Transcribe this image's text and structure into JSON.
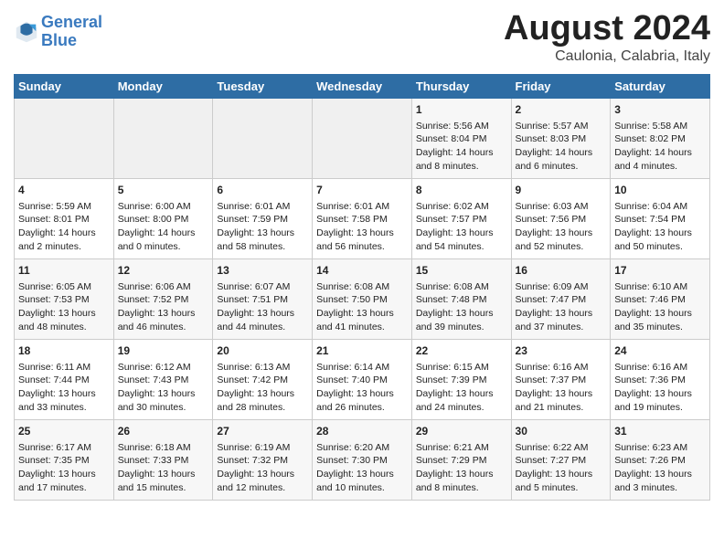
{
  "header": {
    "logo_line1": "General",
    "logo_line2": "Blue",
    "main_title": "August 2024",
    "subtitle": "Caulonia, Calabria, Italy"
  },
  "calendar": {
    "days_of_week": [
      "Sunday",
      "Monday",
      "Tuesday",
      "Wednesday",
      "Thursday",
      "Friday",
      "Saturday"
    ],
    "weeks": [
      [
        {
          "day": "",
          "lines": []
        },
        {
          "day": "",
          "lines": []
        },
        {
          "day": "",
          "lines": []
        },
        {
          "day": "",
          "lines": []
        },
        {
          "day": "1",
          "lines": [
            "Sunrise: 5:56 AM",
            "Sunset: 8:04 PM",
            "Daylight: 14 hours",
            "and 8 minutes."
          ]
        },
        {
          "day": "2",
          "lines": [
            "Sunrise: 5:57 AM",
            "Sunset: 8:03 PM",
            "Daylight: 14 hours",
            "and 6 minutes."
          ]
        },
        {
          "day": "3",
          "lines": [
            "Sunrise: 5:58 AM",
            "Sunset: 8:02 PM",
            "Daylight: 14 hours",
            "and 4 minutes."
          ]
        }
      ],
      [
        {
          "day": "4",
          "lines": [
            "Sunrise: 5:59 AM",
            "Sunset: 8:01 PM",
            "Daylight: 14 hours",
            "and 2 minutes."
          ]
        },
        {
          "day": "5",
          "lines": [
            "Sunrise: 6:00 AM",
            "Sunset: 8:00 PM",
            "Daylight: 14 hours",
            "and 0 minutes."
          ]
        },
        {
          "day": "6",
          "lines": [
            "Sunrise: 6:01 AM",
            "Sunset: 7:59 PM",
            "Daylight: 13 hours",
            "and 58 minutes."
          ]
        },
        {
          "day": "7",
          "lines": [
            "Sunrise: 6:01 AM",
            "Sunset: 7:58 PM",
            "Daylight: 13 hours",
            "and 56 minutes."
          ]
        },
        {
          "day": "8",
          "lines": [
            "Sunrise: 6:02 AM",
            "Sunset: 7:57 PM",
            "Daylight: 13 hours",
            "and 54 minutes."
          ]
        },
        {
          "day": "9",
          "lines": [
            "Sunrise: 6:03 AM",
            "Sunset: 7:56 PM",
            "Daylight: 13 hours",
            "and 52 minutes."
          ]
        },
        {
          "day": "10",
          "lines": [
            "Sunrise: 6:04 AM",
            "Sunset: 7:54 PM",
            "Daylight: 13 hours",
            "and 50 minutes."
          ]
        }
      ],
      [
        {
          "day": "11",
          "lines": [
            "Sunrise: 6:05 AM",
            "Sunset: 7:53 PM",
            "Daylight: 13 hours",
            "and 48 minutes."
          ]
        },
        {
          "day": "12",
          "lines": [
            "Sunrise: 6:06 AM",
            "Sunset: 7:52 PM",
            "Daylight: 13 hours",
            "and 46 minutes."
          ]
        },
        {
          "day": "13",
          "lines": [
            "Sunrise: 6:07 AM",
            "Sunset: 7:51 PM",
            "Daylight: 13 hours",
            "and 44 minutes."
          ]
        },
        {
          "day": "14",
          "lines": [
            "Sunrise: 6:08 AM",
            "Sunset: 7:50 PM",
            "Daylight: 13 hours",
            "and 41 minutes."
          ]
        },
        {
          "day": "15",
          "lines": [
            "Sunrise: 6:08 AM",
            "Sunset: 7:48 PM",
            "Daylight: 13 hours",
            "and 39 minutes."
          ]
        },
        {
          "day": "16",
          "lines": [
            "Sunrise: 6:09 AM",
            "Sunset: 7:47 PM",
            "Daylight: 13 hours",
            "and 37 minutes."
          ]
        },
        {
          "day": "17",
          "lines": [
            "Sunrise: 6:10 AM",
            "Sunset: 7:46 PM",
            "Daylight: 13 hours",
            "and 35 minutes."
          ]
        }
      ],
      [
        {
          "day": "18",
          "lines": [
            "Sunrise: 6:11 AM",
            "Sunset: 7:44 PM",
            "Daylight: 13 hours",
            "and 33 minutes."
          ]
        },
        {
          "day": "19",
          "lines": [
            "Sunrise: 6:12 AM",
            "Sunset: 7:43 PM",
            "Daylight: 13 hours",
            "and 30 minutes."
          ]
        },
        {
          "day": "20",
          "lines": [
            "Sunrise: 6:13 AM",
            "Sunset: 7:42 PM",
            "Daylight: 13 hours",
            "and 28 minutes."
          ]
        },
        {
          "day": "21",
          "lines": [
            "Sunrise: 6:14 AM",
            "Sunset: 7:40 PM",
            "Daylight: 13 hours",
            "and 26 minutes."
          ]
        },
        {
          "day": "22",
          "lines": [
            "Sunrise: 6:15 AM",
            "Sunset: 7:39 PM",
            "Daylight: 13 hours",
            "and 24 minutes."
          ]
        },
        {
          "day": "23",
          "lines": [
            "Sunrise: 6:16 AM",
            "Sunset: 7:37 PM",
            "Daylight: 13 hours",
            "and 21 minutes."
          ]
        },
        {
          "day": "24",
          "lines": [
            "Sunrise: 6:16 AM",
            "Sunset: 7:36 PM",
            "Daylight: 13 hours",
            "and 19 minutes."
          ]
        }
      ],
      [
        {
          "day": "25",
          "lines": [
            "Sunrise: 6:17 AM",
            "Sunset: 7:35 PM",
            "Daylight: 13 hours",
            "and 17 minutes."
          ]
        },
        {
          "day": "26",
          "lines": [
            "Sunrise: 6:18 AM",
            "Sunset: 7:33 PM",
            "Daylight: 13 hours",
            "and 15 minutes."
          ]
        },
        {
          "day": "27",
          "lines": [
            "Sunrise: 6:19 AM",
            "Sunset: 7:32 PM",
            "Daylight: 13 hours",
            "and 12 minutes."
          ]
        },
        {
          "day": "28",
          "lines": [
            "Sunrise: 6:20 AM",
            "Sunset: 7:30 PM",
            "Daylight: 13 hours",
            "and 10 minutes."
          ]
        },
        {
          "day": "29",
          "lines": [
            "Sunrise: 6:21 AM",
            "Sunset: 7:29 PM",
            "Daylight: 13 hours",
            "and 8 minutes."
          ]
        },
        {
          "day": "30",
          "lines": [
            "Sunrise: 6:22 AM",
            "Sunset: 7:27 PM",
            "Daylight: 13 hours",
            "and 5 minutes."
          ]
        },
        {
          "day": "31",
          "lines": [
            "Sunrise: 6:23 AM",
            "Sunset: 7:26 PM",
            "Daylight: 13 hours",
            "and 3 minutes."
          ]
        }
      ]
    ]
  }
}
